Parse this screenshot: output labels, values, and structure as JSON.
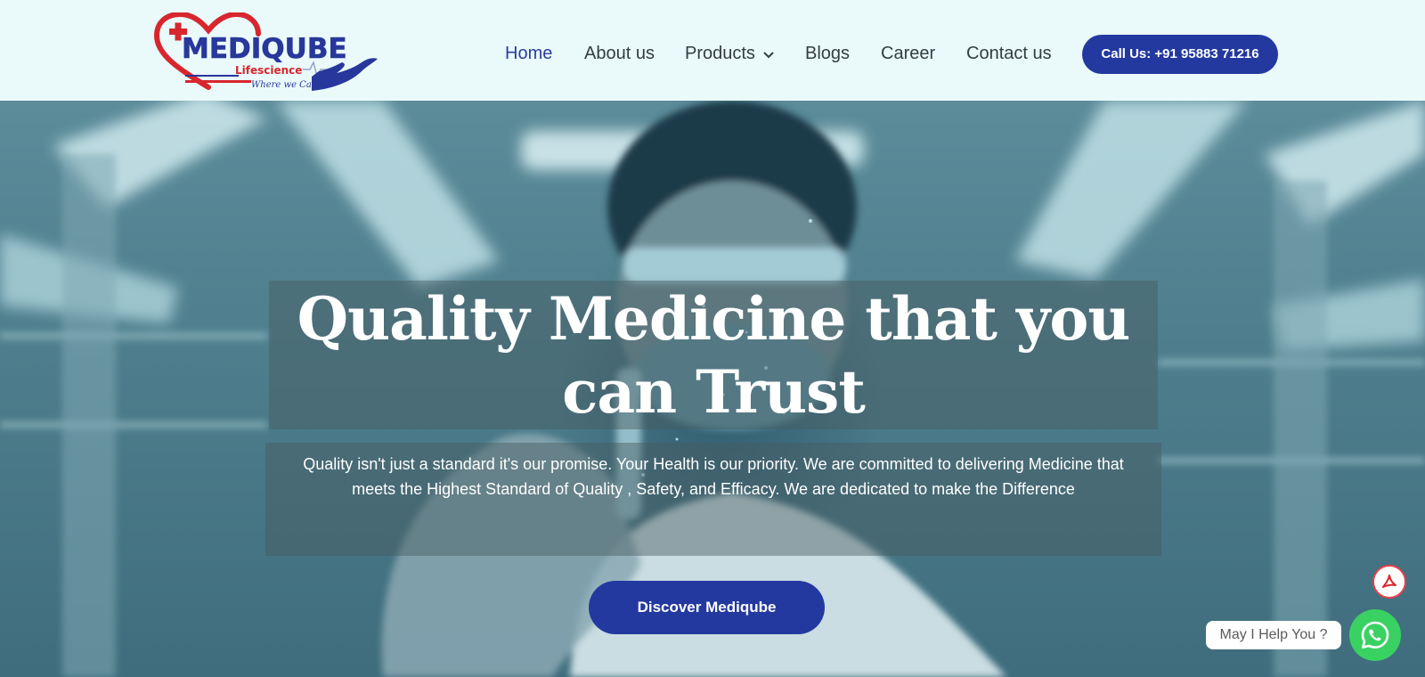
{
  "header": {
    "logo": {
      "wordmark": "MEDIQUBE",
      "subtitle": "Lifescience",
      "tagline": "Where we Care!"
    },
    "nav": [
      {
        "label": "Home",
        "active": true
      },
      {
        "label": "About us",
        "active": false
      },
      {
        "label": "Products",
        "active": false,
        "has_dropdown": true
      },
      {
        "label": "Blogs",
        "active": false
      },
      {
        "label": "Career",
        "active": false
      },
      {
        "label": "Contact us",
        "active": false
      }
    ],
    "call_button": "Call Us: +91 95883 71216"
  },
  "hero": {
    "title": "Quality Medicine that you can Trust",
    "description": "Quality isn't just a standard it's our promise. Your Health is our priority. We are committed to delivering Medicine that meets the Highest Standard of Quality , Safety, and Efficacy. We are dedicated to make the Difference",
    "cta": "Discover Mediqube"
  },
  "widgets": {
    "pdf_icon": "pdf-icon",
    "help_text": "May I Help You ?",
    "chat_icon": "whatsapp-icon"
  },
  "colors": {
    "brand_blue": "#23399f",
    "brand_red": "#d8262e",
    "header_bg": "#eafafa",
    "whatsapp_green": "#3ad163"
  }
}
